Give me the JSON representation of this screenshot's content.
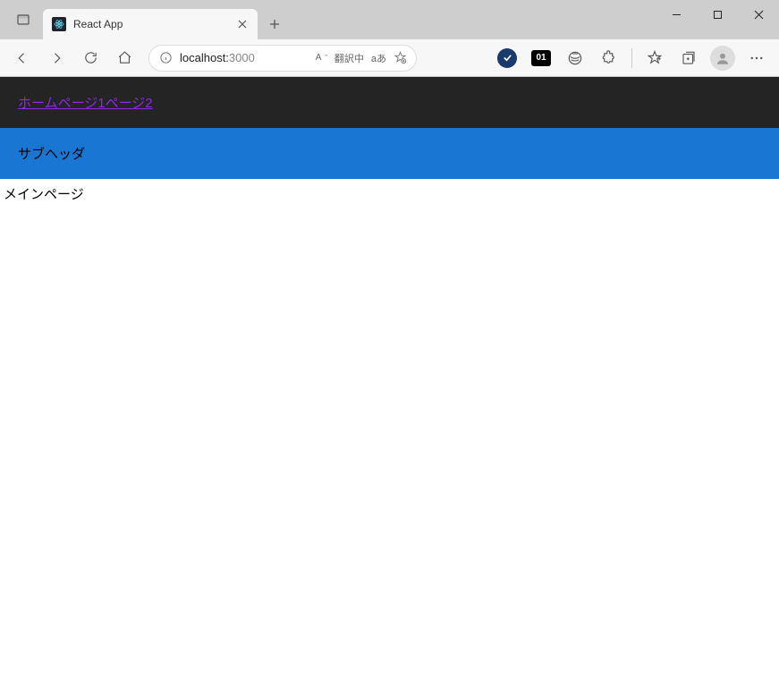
{
  "browser": {
    "tab": {
      "title": "React App",
      "favicon": "react-icon"
    },
    "address": {
      "host": "localhost:",
      "port": "3000",
      "translate_label": "翻訳中",
      "lang_label": "aあ"
    },
    "extensions": {
      "check": "✓",
      "num": "01"
    }
  },
  "page": {
    "nav": {
      "links": [
        {
          "label": "ホーム"
        },
        {
          "label": "ページ1"
        },
        {
          "label": "ページ2"
        }
      ]
    },
    "sub_header": "サブヘッダ",
    "main_text": "メインページ"
  }
}
